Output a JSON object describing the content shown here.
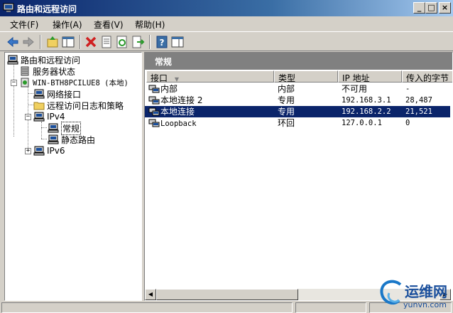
{
  "window": {
    "title": "路由和远程访问",
    "buttons": [
      "_",
      "□",
      "×"
    ]
  },
  "menu": [
    {
      "label": "文件(F)"
    },
    {
      "label": "操作(A)"
    },
    {
      "label": "查看(V)"
    },
    {
      "label": "帮助(H)"
    }
  ],
  "toolbar": {
    "icons": [
      "back-icon",
      "forward-icon",
      "up-icon",
      "show-hide-tree-icon",
      "delete-icon",
      "properties-icon",
      "refresh-icon",
      "export-icon",
      "help-icon",
      "show-hide-action-icon"
    ]
  },
  "tree": {
    "root": "路由和远程访问",
    "server_status": "服务器状态",
    "server": "WIN-BTH8PCILUE8 (本地)",
    "network_interfaces": "网络接口",
    "remote_logging": "远程访问日志和策略",
    "ipv4": "IPv4",
    "general": "常规",
    "static_routes": "静态路由",
    "ipv6": "IPv6"
  },
  "details": {
    "header": "常规",
    "columns": [
      "接口",
      "类型",
      "IP 地址",
      "传入的字节"
    ],
    "rows": [
      {
        "name": "内部",
        "type": "内部",
        "ip": "不可用",
        "bytes": "-"
      },
      {
        "name": "本地连接 2",
        "type": "专用",
        "ip": "192.168.3.1",
        "bytes": "28,487"
      },
      {
        "name": "本地连接",
        "type": "专用",
        "ip": "192.168.2.2",
        "bytes": "21,521",
        "selected": true
      },
      {
        "name": "Loopback",
        "type": "环回",
        "ip": "127.0.0.1",
        "bytes": "0"
      }
    ]
  },
  "watermark": {
    "text": "运维网",
    "url": "yunvn.com"
  },
  "colors": {
    "title_gradient_start": "#0a246a",
    "selection": "#0a246a",
    "pane_header": "#808080"
  }
}
